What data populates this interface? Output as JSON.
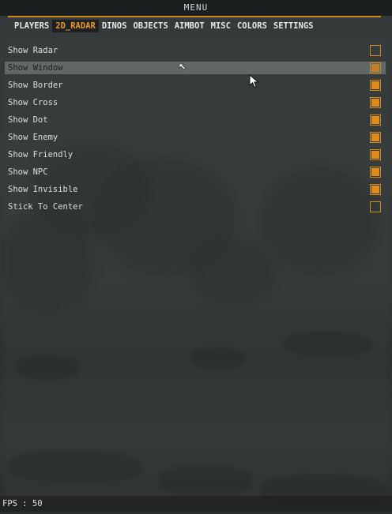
{
  "window": {
    "title": "MENU"
  },
  "tabs": [
    {
      "label": "PLAYERS",
      "active": false
    },
    {
      "label": "2D_RADAR",
      "active": true
    },
    {
      "label": "DINOS",
      "active": false
    },
    {
      "label": "OBJECTS",
      "active": false
    },
    {
      "label": "AIMBOT",
      "active": false
    },
    {
      "label": "MISC",
      "active": false
    },
    {
      "label": "COLORS",
      "active": false
    },
    {
      "label": "SETTINGS",
      "active": false
    }
  ],
  "options": [
    {
      "label": "Show Radar",
      "checked": false
    },
    {
      "label": "Show Window",
      "checked": true,
      "highlighted": true
    },
    {
      "label": "Show Border",
      "checked": true
    },
    {
      "label": "Show Cross",
      "checked": true
    },
    {
      "label": "Show Dot",
      "checked": true
    },
    {
      "label": "Show Enemy",
      "checked": true
    },
    {
      "label": "Show Friendly",
      "checked": true
    },
    {
      "label": "Show NPC",
      "checked": true
    },
    {
      "label": "Show Invisible",
      "checked": true
    },
    {
      "label": "Stick To Center",
      "checked": false
    }
  ],
  "status": {
    "fps_text": "FPS : 50"
  },
  "colors": {
    "accent": "#d08a1c",
    "active_tab_text": "#e59a2a",
    "checked_fill": "#e08a1c"
  },
  "icons": {
    "cursor": "arrow-cursor-icon",
    "resize": "resize-cursor-icon"
  }
}
